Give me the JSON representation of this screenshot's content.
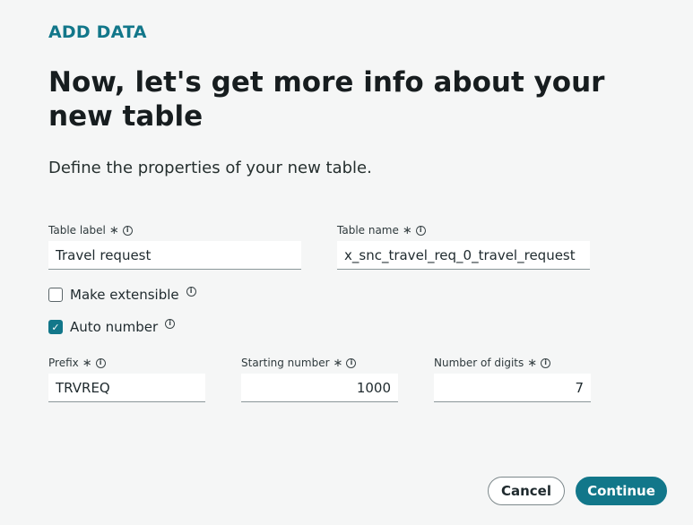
{
  "header": {
    "eyebrow": "ADD DATA",
    "title": "Now, let's get more info about your new table",
    "subtitle": "Define the properties of your new table."
  },
  "form": {
    "table_label": {
      "label": "Table label",
      "required_mark": "∗",
      "value": "Travel request"
    },
    "table_name": {
      "label": "Table name",
      "required_mark": "∗",
      "value": "x_snc_travel_req_0_travel_request"
    },
    "make_extensible": {
      "label": "Make extensible",
      "checked": false
    },
    "auto_number": {
      "label": "Auto number",
      "checked": true
    },
    "prefix": {
      "label": "Prefix",
      "required_mark": "∗",
      "value": "TRVREQ"
    },
    "starting_number": {
      "label": "Starting number",
      "required_mark": "∗",
      "value": "1000"
    },
    "number_of_digits": {
      "label": "Number of digits",
      "required_mark": "∗",
      "value": "7"
    }
  },
  "footer": {
    "cancel_label": "Cancel",
    "continue_label": "Continue"
  },
  "icons": {
    "info": "info-icon",
    "check": "check-icon"
  },
  "colors": {
    "accent": "#12778a",
    "background": "#f5f6f6",
    "text": "#1f2a2e"
  }
}
